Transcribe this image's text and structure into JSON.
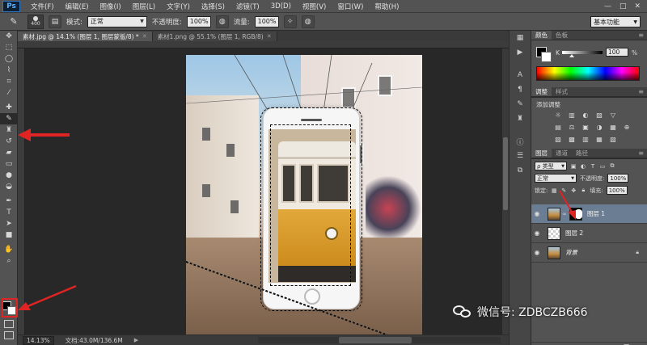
{
  "menubar": {
    "logo": "Ps",
    "items": [
      "文件(F)",
      "编辑(E)",
      "图像(I)",
      "图层(L)",
      "文字(Y)",
      "选择(S)",
      "滤镜(T)",
      "3D(D)",
      "视图(V)",
      "窗口(W)",
      "帮助(H)"
    ],
    "window_controls": [
      "—",
      "□",
      "✕"
    ]
  },
  "options": {
    "brush_size": "400",
    "mode_label": "模式:",
    "mode_value": "正常",
    "opacity_label": "不透明度:",
    "opacity_value": "100%",
    "flow_label": "流量:",
    "flow_value": "100%",
    "workspace": "基本功能"
  },
  "doc_tabs": [
    {
      "title": "素材.jpg @ 14.1% (图层 1, 图层蒙版/8) *",
      "active": true
    },
    {
      "title": "素材1.png @ 55.1% (图层 1, RGB/8)",
      "active": false
    }
  ],
  "status": {
    "zoom": "14.13%",
    "doc_info": "文档:43.0M/136.6M"
  },
  "color_panel": {
    "tabs": [
      "颜色",
      "色板"
    ],
    "channel": "K",
    "value": "100",
    "unit": "%"
  },
  "adjust_panel": {
    "tabs": [
      "调整",
      "样式"
    ],
    "title": "添加调整",
    "rows": [
      [
        "☼",
        "▥",
        "◐",
        "▨",
        "▽"
      ],
      [
        "▤",
        "⚖",
        "▣",
        "◑",
        "▦",
        "⊕"
      ],
      [
        "▧",
        "▩",
        "▥",
        "▦",
        "▨"
      ]
    ]
  },
  "layers_panel": {
    "tabs": [
      "图层",
      "通道",
      "路径"
    ],
    "filter_kind": "ρ 类型",
    "blend_mode": "正常",
    "opacity_label": "不透明度:",
    "opacity_value": "100%",
    "lock_label": "锁定:",
    "fill_label": "填充:",
    "fill_value": "100%",
    "layers": [
      {
        "name": "图层 1",
        "selected": true,
        "thumb": "photo",
        "has_mask": true
      },
      {
        "name": "图层 2",
        "selected": false,
        "thumb": "check",
        "has_mask": false
      },
      {
        "name": "背景",
        "selected": false,
        "thumb": "photo",
        "has_mask": false,
        "locked": true
      }
    ]
  },
  "watermark": {
    "text": "微信号: ZDBCZB666"
  },
  "colors": {
    "annotation_red": "#e02424",
    "ui_bg": "#535353",
    "canvas_bg": "#282828",
    "layer_selected": "#6b7d92"
  }
}
